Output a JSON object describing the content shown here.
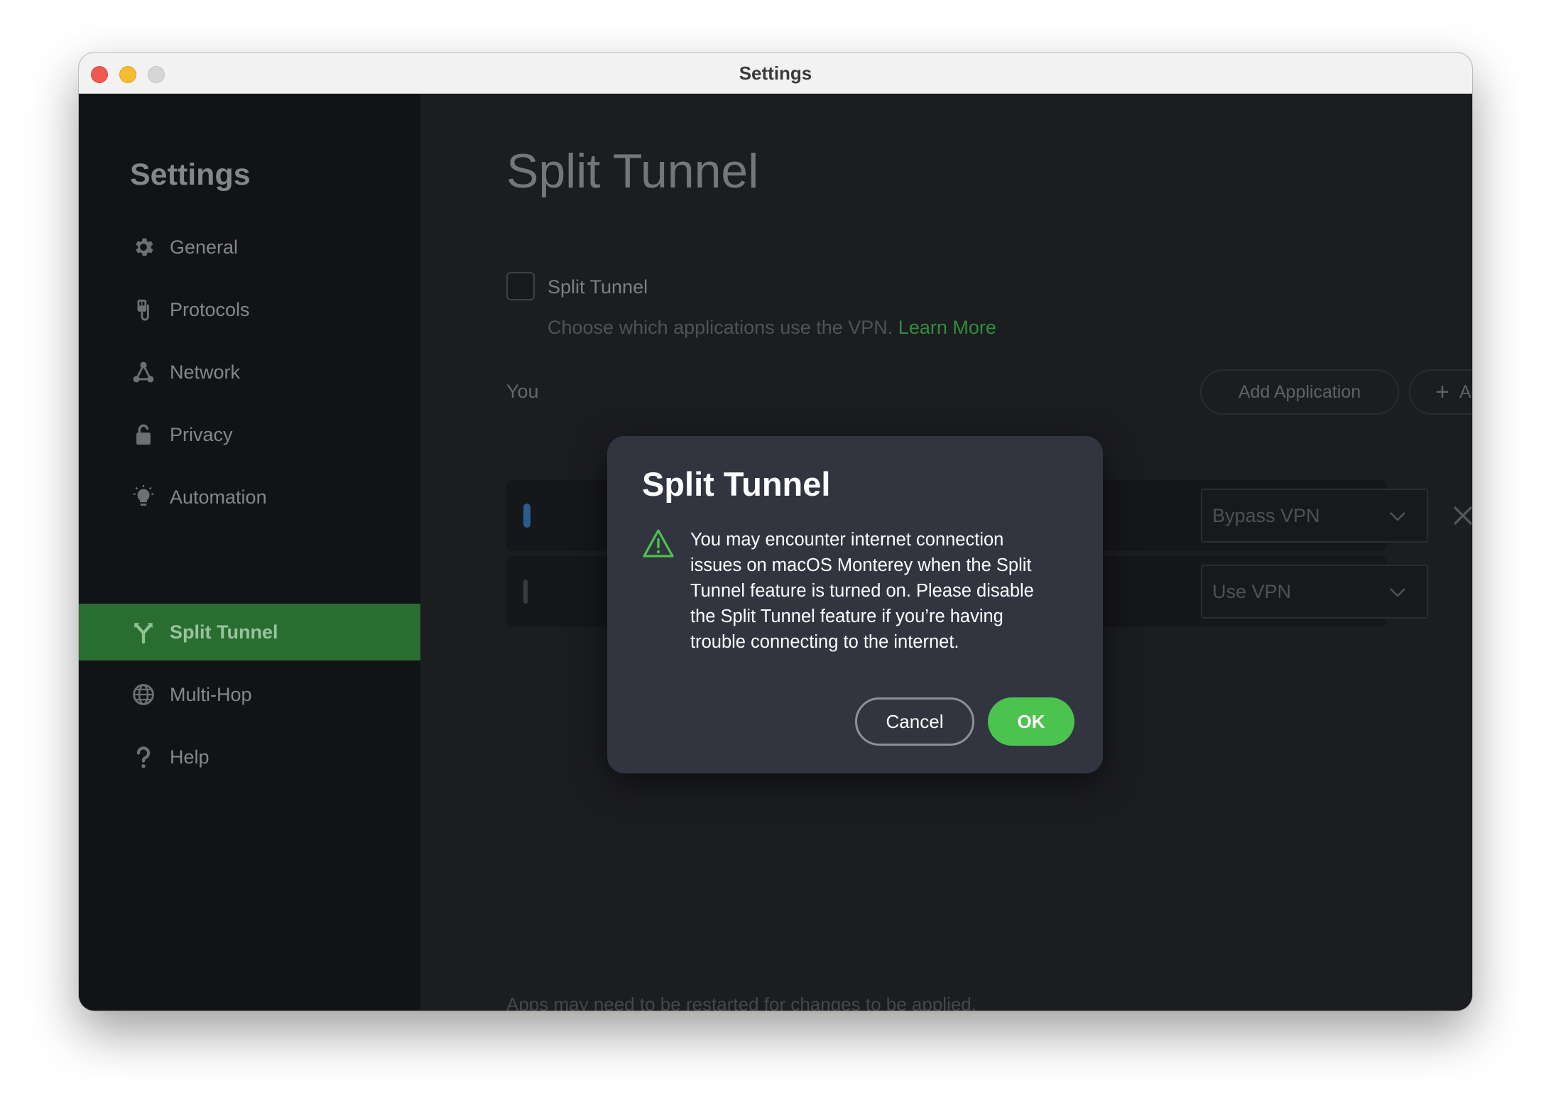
{
  "window": {
    "title": "Settings"
  },
  "sidebar": {
    "title": "Settings",
    "items": [
      {
        "label": "General",
        "icon": "gear-icon"
      },
      {
        "label": "Protocols",
        "icon": "protocols-icon"
      },
      {
        "label": "Network",
        "icon": "network-icon"
      },
      {
        "label": "Privacy",
        "icon": "lock-icon"
      },
      {
        "label": "Automation",
        "icon": "lightbulb-icon"
      },
      {
        "label": "Split Tunnel",
        "icon": "split-tunnel-icon",
        "active": true
      },
      {
        "label": "Multi-Hop",
        "icon": "globe-icon"
      },
      {
        "label": "Help",
        "icon": "question-icon"
      }
    ]
  },
  "main": {
    "title": "Split Tunnel",
    "checkbox_label": "Split Tunnel",
    "checkbox_checked": false,
    "description": "Choose which applications use the VPN.",
    "learn_more": "Learn More",
    "section_label_partial": "You",
    "add_application": "Add Application",
    "add_ip_address": "Add IP Address",
    "rows": [
      {
        "mode": "Bypass VPN"
      },
      {
        "mode": "Use VPN"
      }
    ],
    "footer_note": "Apps may need to be restarted for changes to be applied."
  },
  "modal": {
    "title": "Split Tunnel",
    "message_lines": [
      "You may encounter internet connection",
      "issues on macOS Monterey when the Split",
      "Tunnel feature is turned on. Please disable",
      "the Split Tunnel feature if you’re having",
      "trouble connecting to the internet."
    ],
    "cancel_label": "Cancel",
    "ok_label": "OK"
  },
  "colors": {
    "accent_green": "#4cc34e",
    "active_nav_bg": "#2a6d31",
    "sidebar_bg": "#121317",
    "main_bg": "#1c1d21",
    "modal_bg": "#323540"
  }
}
